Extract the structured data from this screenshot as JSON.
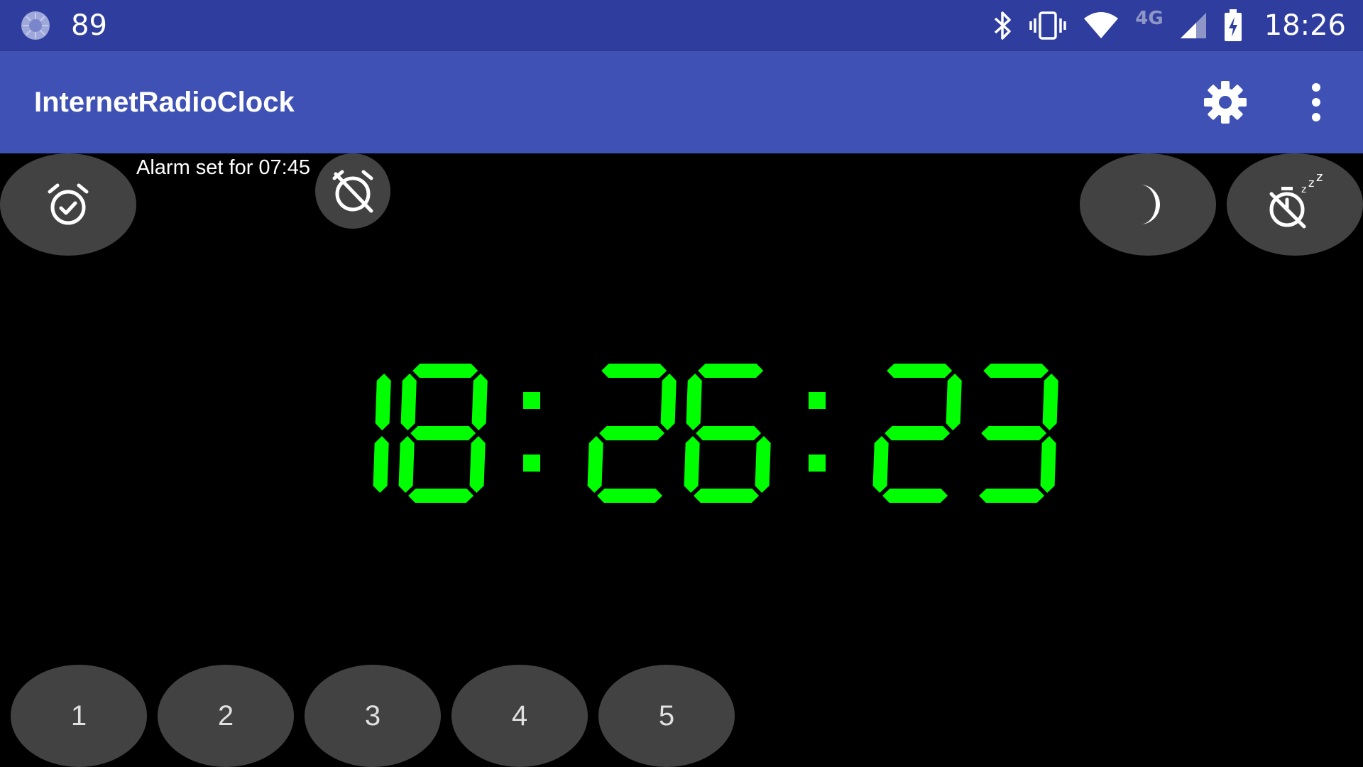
{
  "status_bar": {
    "notification_count": "89",
    "network_type": "4G",
    "time": "18:26",
    "icons": [
      "loading-icon",
      "bluetooth-icon",
      "vibrate-icon",
      "wifi-icon",
      "signal-icon",
      "battery-charging-icon"
    ]
  },
  "toolbar": {
    "title": "InternetRadioClock",
    "settings_icon": "gear-icon",
    "more_icon": "more-vert-icon"
  },
  "alarm": {
    "status_text": "Alarm set for 07:45"
  },
  "clock": {
    "time": "18:26:23",
    "color": "#00ff00"
  },
  "presets": {
    "buttons": [
      "1",
      "2",
      "3",
      "4",
      "5"
    ]
  },
  "colors": {
    "status_bar": "#2f3e9e",
    "toolbar": "#3f51b5",
    "button_bg": "#424242",
    "background": "#000000"
  }
}
